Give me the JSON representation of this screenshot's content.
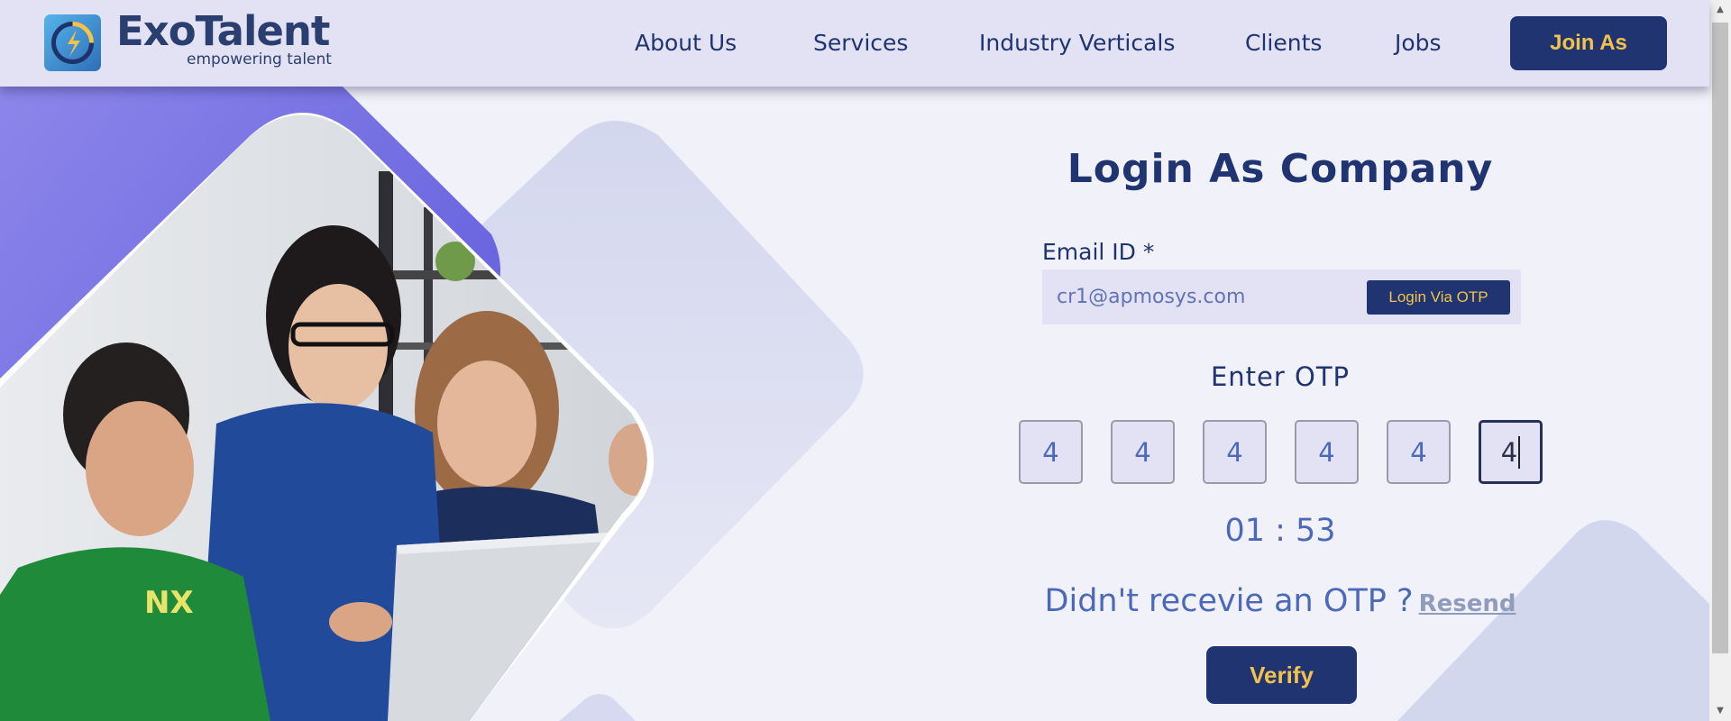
{
  "brand": {
    "name": "ExoTalent",
    "tagline": "empowering talent",
    "accent": "#1f3470",
    "button_text_color": "#f3c24a"
  },
  "nav": {
    "links": [
      "About Us",
      "Services",
      "Industry Verticals",
      "Clients",
      "Jobs"
    ],
    "join_label": "Join As"
  },
  "form": {
    "title": "Login As Company",
    "email_label": "Email ID *",
    "email_value": "cr1@apmosys.com",
    "otp_login_label": "Login Via OTP",
    "otp_label": "Enter OTP",
    "otp_digits": [
      "4",
      "4",
      "4",
      "4",
      "4",
      "4"
    ],
    "timer": "01 : 53",
    "didnt_receive": "Didn't recevie an OTP ?",
    "resend_label": "Resend",
    "verify_label": "Verify"
  },
  "icons": {
    "logo": "exotalent-logo-icon",
    "scroll_up": "scroll-up-icon",
    "scroll_down": "scroll-down-icon"
  }
}
